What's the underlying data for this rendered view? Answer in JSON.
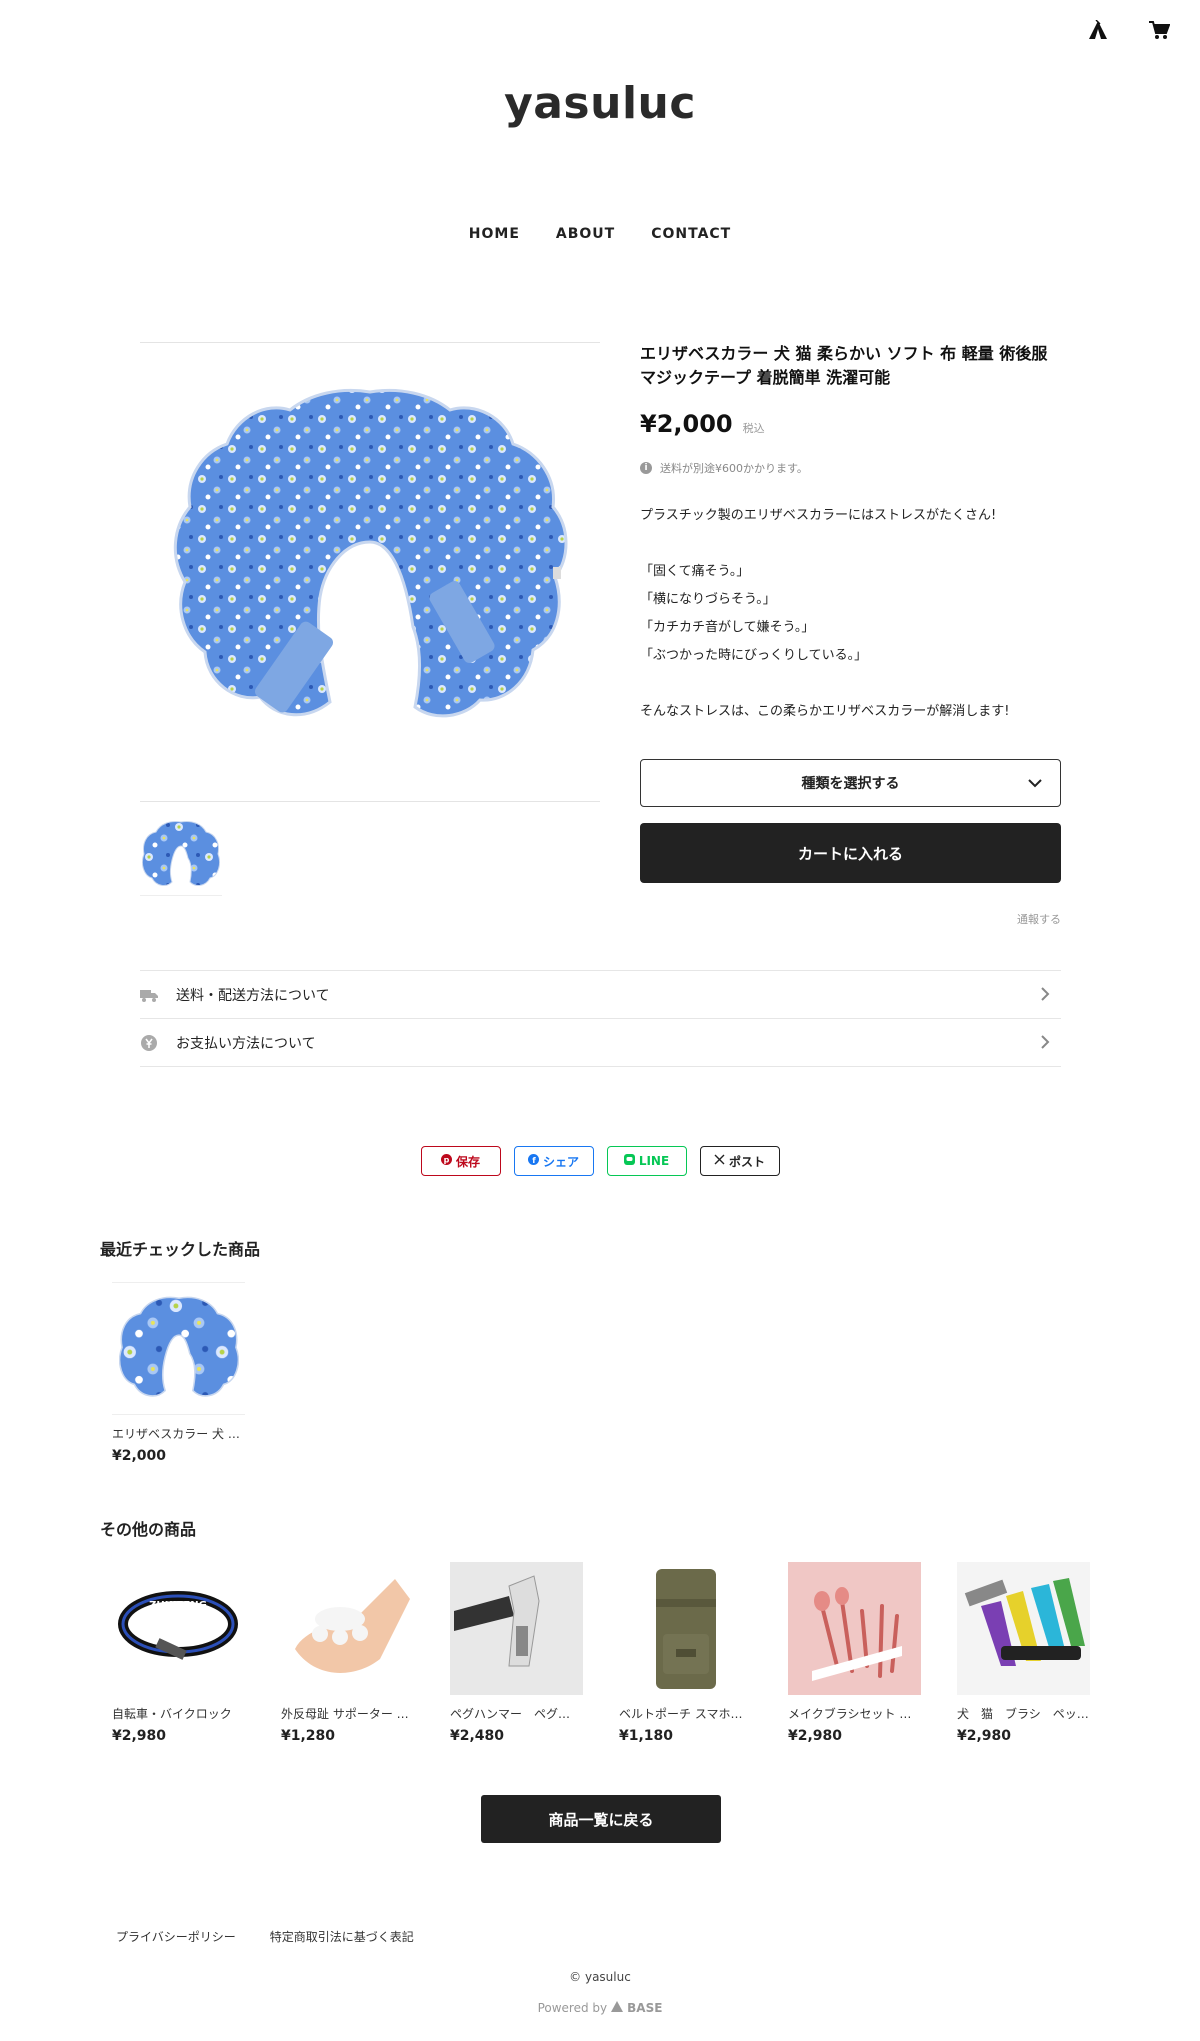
{
  "header": {
    "shop_name": "yasuluc",
    "icons": [
      "base-tent-icon",
      "cart-icon"
    ]
  },
  "nav": {
    "items": [
      "HOME",
      "ABOUT",
      "CONTACT"
    ]
  },
  "product": {
    "title": "エリザベスカラー 犬 猫 柔らかい ソフト 布 軽量 術後服 マジックテープ 着脱簡単 洗濯可能",
    "price": "¥2,000",
    "tax_label": "税込",
    "shipping_note": "送料が別途¥600かかります。",
    "description": [
      "プラスチック製のエリザベスカラーにはストレスがたくさん!",
      "",
      "「固くて痛そう。」",
      "「横になりづらそう。」",
      "「カチカチ音がして嫌そう。」",
      "「ぶつかった時にびっくりしている。」",
      "",
      "そんなストレスは、この柔らかエリザベスカラーが解消します!"
    ],
    "variant_label": "種類を選択する",
    "cart_label": "カートに入れる",
    "report_label": "通報する"
  },
  "info_links": {
    "shipping": "送料・配送方法について",
    "payment": "お支払い方法について"
  },
  "share": {
    "pinterest": "保存",
    "facebook": "シェア",
    "line": "LINE",
    "x": "ポスト"
  },
  "recent": {
    "title": "最近チェックした商品",
    "items": [
      {
        "name": "エリザベスカラー 犬 …",
        "price": "¥2,000"
      }
    ]
  },
  "others": {
    "title": "その他の商品",
    "items": [
      {
        "name": "自転車・バイクロック",
        "price": "¥2,980"
      },
      {
        "name": "外反母趾 サポーター …",
        "price": "¥1,280"
      },
      {
        "name": "ペグハンマー　ペグ…",
        "price": "¥2,480"
      },
      {
        "name": "ベルトポーチ スマホ…",
        "price": "¥1,180"
      },
      {
        "name": "メイクブラシセット 可…",
        "price": "¥2,980"
      },
      {
        "name": "犬　猫　ブラシ　ペッ…",
        "price": "¥2,980"
      }
    ]
  },
  "back_label": "商品一覧に戻る",
  "footer": {
    "privacy": "プライバシーポリシー",
    "law": "特定商取引法に基づく表記",
    "copyright": "© yasuluc",
    "powered_by": "Powered by",
    "powered_brand": "BASE"
  },
  "colors": {
    "collar_blue": "#5b8fe0",
    "pinterest": "#bd081c",
    "facebook": "#1877f2",
    "line": "#06c755",
    "dark": "#222222"
  }
}
